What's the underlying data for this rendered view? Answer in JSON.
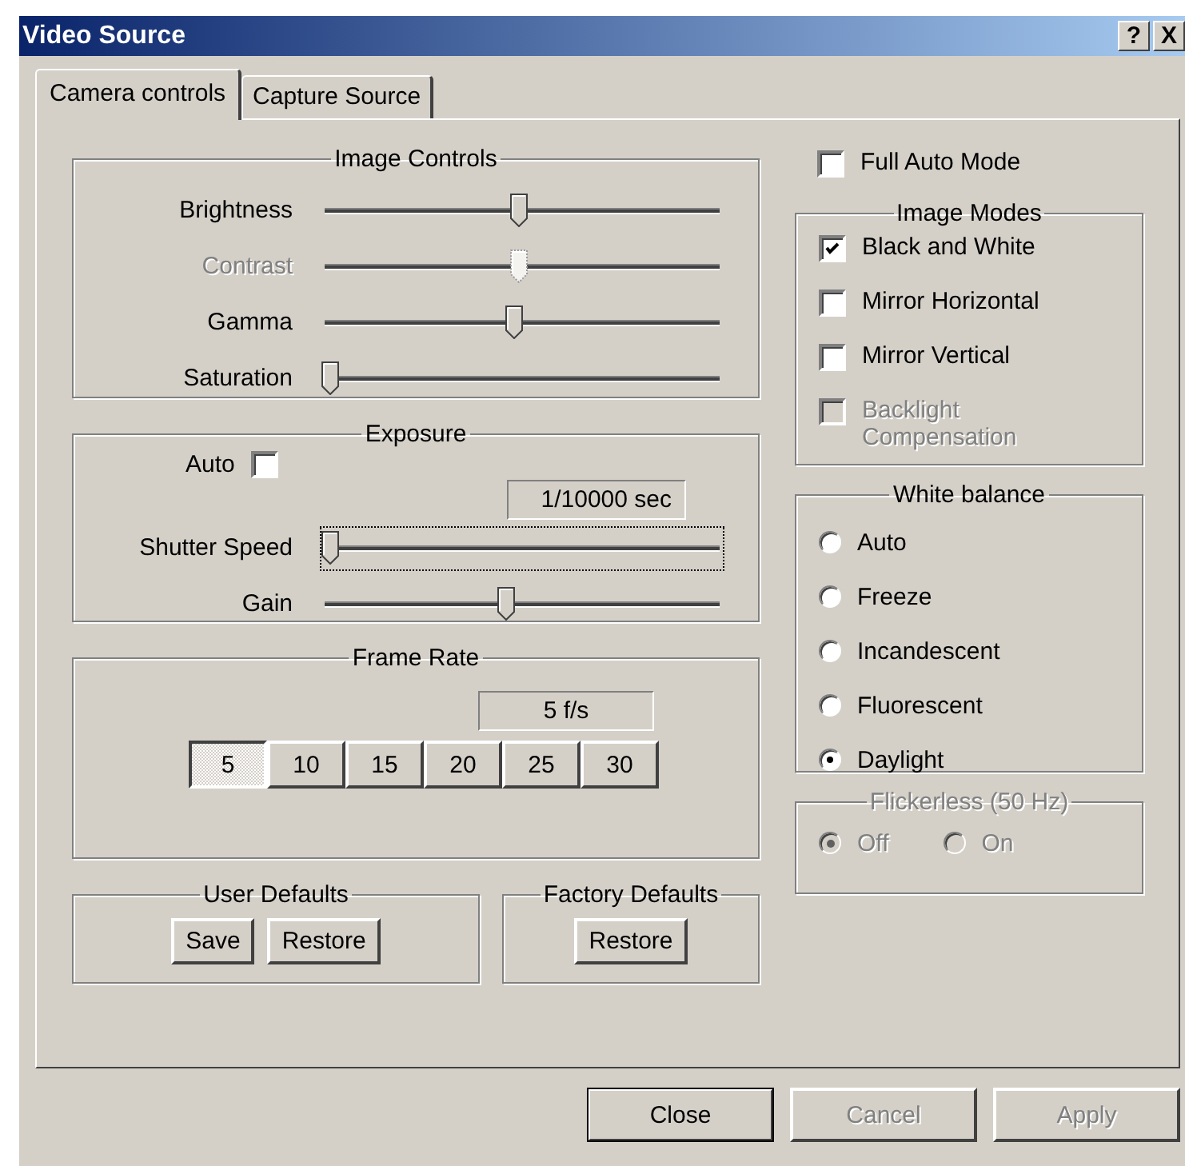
{
  "window": {
    "title": "Video Source",
    "help_button": "?",
    "close_button": "X"
  },
  "tabs": [
    {
      "label": "Camera controls",
      "selected": true
    },
    {
      "label": "Capture Source",
      "selected": false
    }
  ],
  "image_controls": {
    "title": "Image Controls",
    "sliders": [
      {
        "label": "Brightness",
        "level": 0.49,
        "disabled": false
      },
      {
        "label": "Contrast",
        "level": 0.49,
        "disabled": true
      },
      {
        "label": "Gamma",
        "level": 0.48,
        "disabled": false
      },
      {
        "label": "Saturation",
        "level": 0,
        "disabled": false
      }
    ]
  },
  "exposure": {
    "title": "Exposure",
    "auto": {
      "label": "Auto",
      "checked": false
    },
    "readout": "1/10000 sec",
    "sliders": [
      {
        "label": "Shutter Speed",
        "level": 0,
        "focused": true
      },
      {
        "label": "Gain",
        "level": 0.46,
        "focused": false
      }
    ]
  },
  "frame_rate": {
    "title": "Frame Rate",
    "readout": "5 f/s",
    "buttons": [
      {
        "label": "5",
        "selected": true
      },
      {
        "label": "10",
        "selected": false
      },
      {
        "label": "15",
        "selected": false
      },
      {
        "label": "20",
        "selected": false
      },
      {
        "label": "25",
        "selected": false
      },
      {
        "label": "30",
        "selected": false
      }
    ]
  },
  "user_defaults": {
    "title": "User Defaults",
    "buttons": [
      "Save",
      "Restore"
    ]
  },
  "factory_defaults": {
    "title": "Factory Defaults",
    "buttons": [
      "Restore"
    ]
  },
  "full_auto_mode": {
    "label": "Full Auto Mode",
    "checked": false
  },
  "image_modes": {
    "title": "Image Modes",
    "options": [
      {
        "label": "Black and White",
        "checked": true,
        "disabled": false
      },
      {
        "label": "Mirror Horizontal",
        "checked": false,
        "disabled": false
      },
      {
        "label": "Mirror Vertical",
        "checked": false,
        "disabled": false
      },
      {
        "label": "Backlight Compensation",
        "checked": false,
        "disabled": true
      }
    ]
  },
  "white_balance": {
    "title": "White balance",
    "options": [
      {
        "label": "Auto",
        "selected": false
      },
      {
        "label": "Freeze",
        "selected": false
      },
      {
        "label": "Incandescent",
        "selected": false
      },
      {
        "label": "Fluorescent",
        "selected": false
      },
      {
        "label": "Daylight",
        "selected": true
      }
    ]
  },
  "flickerless": {
    "title": "Flickerless (50 Hz)",
    "disabled": true,
    "options": [
      {
        "label": "Off",
        "selected": true
      },
      {
        "label": "On",
        "selected": false
      }
    ]
  },
  "footer_buttons": [
    {
      "label": "Close",
      "disabled": false,
      "default": true
    },
    {
      "label": "Cancel",
      "disabled": true,
      "default": false
    },
    {
      "label": "Apply",
      "disabled": true,
      "default": false
    }
  ]
}
